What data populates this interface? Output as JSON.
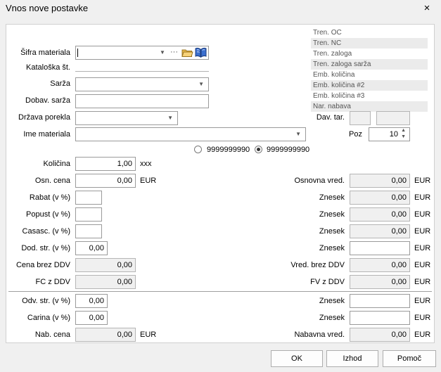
{
  "window": {
    "title": "Vnos nove postavke",
    "close_icon": "×"
  },
  "info_panel": [
    "Tren. OC",
    "Tren. NC",
    "Tren. zaloga",
    "Tren. zaloga sarža",
    "Emb. količina",
    "Emb. količina #2",
    "Emb. količina #3",
    "Nar. nabava"
  ],
  "form": {
    "sifra_label": "Šifra materiala",
    "sifra_value": "",
    "sifra_dots": "···",
    "katalog_label": "Kataloška št.",
    "sarza_label": "Sarža",
    "sarza_value": "",
    "dobav_label": "Dobav. sarža",
    "dobav_value": "",
    "drzava_label": "Država porekla",
    "drzava_value": "",
    "ime_label": "Ime materiala",
    "ime_value": "",
    "dav_label": "Dav. tar.",
    "dav_value1": "",
    "dav_value2": "",
    "poz_label": "Poz",
    "poz_value": "10",
    "radio1_label": "9999999990",
    "radio2_label": "9999999990",
    "radio_selected": 2,
    "kolicina_label": "Količina",
    "kolicina_value": "1,00",
    "kolicina_unit": "xxx",
    "osn_cena_label": "Osn. cena",
    "osn_cena_value": "0,00",
    "currency": "EUR",
    "rabat_label": "Rabat (v %)",
    "rabat_value": "",
    "popust_label": "Popust (v %)",
    "popust_value": "",
    "casasc_label": "Casasc. (v %)",
    "casasc_value": "",
    "dod_label": "Dod. str. (v %)",
    "dod_value": "0,00",
    "cena_brez_label": "Cena brez DDV",
    "cena_brez_value": "0,00",
    "fc_label": "FC z DDV",
    "fc_value": "0,00",
    "odv_label": "Odv. str. (v %)",
    "odv_value": "0,00",
    "carina_label": "Carina (v %)",
    "carina_value": "0,00",
    "nab_cena_label": "Nab. cena",
    "nab_cena_value": "0,00",
    "osn_vred_label": "Osnovna vred.",
    "osn_vred_value": "0,00",
    "znesek_label": "Znesek",
    "zn1": "0,00",
    "zn2": "0,00",
    "zn3": "0,00",
    "zn4": "",
    "vred_brez_label": "Vred. brez DDV",
    "vred_brez_value": "0,00",
    "fv_label": "FV z DDV",
    "fv_value": "0,00",
    "zn5": "",
    "zn6": "",
    "nab_vred_label": "Nabavna vred.",
    "nab_vred_value": "0,00"
  },
  "buttons": {
    "ok": "OK",
    "izhod": "Izhod",
    "pomoc": "Pomoč"
  }
}
